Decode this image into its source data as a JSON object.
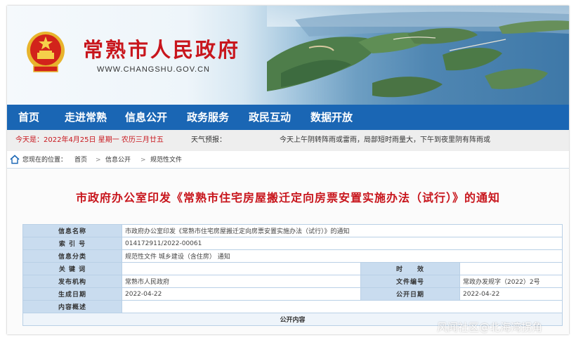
{
  "header": {
    "site_title": "常熟市人民政府",
    "site_url": "WWW.CHANGSHU.GOV.CN"
  },
  "nav": {
    "items": [
      {
        "label": "首页"
      },
      {
        "label": "走进常熟"
      },
      {
        "label": "信息公开"
      },
      {
        "label": "政务服务"
      },
      {
        "label": "政民互动"
      },
      {
        "label": "数据开放"
      }
    ]
  },
  "infobar": {
    "date": "今天是：2022年4月25日 星期一 农历三月廿五",
    "weather_label": "天气预报：",
    "weather_text": "今天上午阴转阵雨或雷雨，局部短时雨量大，下午到夜里阴有阵雨或"
  },
  "breadcrumb": {
    "prefix": "您现在的位置：",
    "items": [
      "首页",
      "信息公开",
      "规范性文件"
    ],
    "separator": ">"
  },
  "document": {
    "title": "市政府办公室印发《常熟市住宅房屋搬迁定向房票安置实施办法（试行）》的通知"
  },
  "meta": {
    "info_name_label": "信息名称",
    "info_name_value": "市政府办公室印发《常熟市住宅房屋搬迁定向房票安置实施办法（试行）》的通知",
    "index_label": "索 引 号",
    "index_value": "014172911/2022-00061",
    "category_label": "信息分类",
    "category_value": "规范性文件 城乡建设（含住房） 通知",
    "keywords_label": "关 键 词",
    "keywords_value": "",
    "timeliness_label": "时　　效",
    "timeliness_value": "",
    "issuer_label": "发布机构",
    "issuer_value": "常熟市人民政府",
    "docno_label": "文件编号",
    "docno_value": "常政办发规字（2022）2号",
    "effective_label": "生成日期",
    "effective_value": "2022-04-22",
    "public_date_label": "公开日期",
    "public_date_value": "2022-04-22",
    "summary_label": "内容概述",
    "summary_value": "",
    "public_content_label": "公开内容"
  },
  "watermark": "风闻社区@北海湾拐角",
  "colors": {
    "nav_bg": "#1a66b4",
    "title_red": "#c8161d",
    "label_bg": "#c9dcef"
  }
}
